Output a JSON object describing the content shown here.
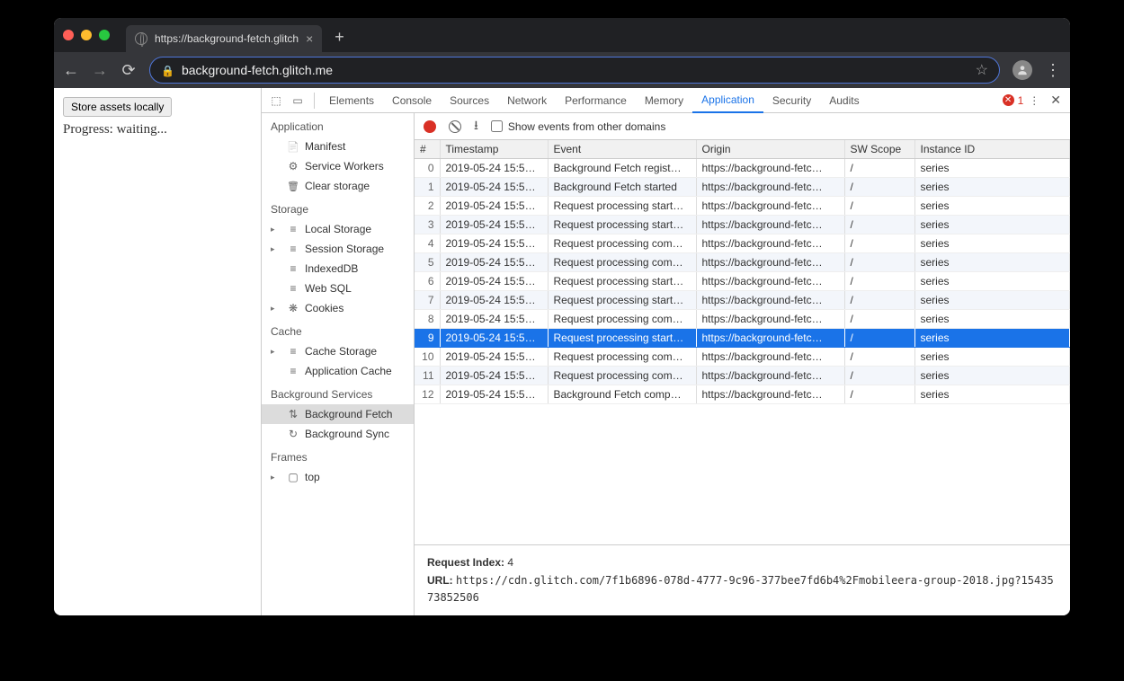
{
  "browser": {
    "tab_title": "https://background-fetch.glitch",
    "url_display": "background-fetch.glitch.me"
  },
  "page": {
    "button_label": "Store assets locally",
    "progress_text": "Progress: waiting..."
  },
  "devtools": {
    "tabs": [
      "Elements",
      "Console",
      "Sources",
      "Network",
      "Performance",
      "Memory",
      "Application",
      "Security",
      "Audits"
    ],
    "active_tab": "Application",
    "error_count": "1",
    "sidebar": {
      "groups": [
        {
          "title": "Application",
          "items": [
            {
              "icon": "i-file",
              "label": "Manifest"
            },
            {
              "icon": "i-gear",
              "label": "Service Workers"
            },
            {
              "icon": "i-trash",
              "label": "Clear storage"
            }
          ]
        },
        {
          "title": "Storage",
          "items": [
            {
              "tri": "▸",
              "icon": "i-db",
              "label": "Local Storage"
            },
            {
              "tri": "▸",
              "icon": "i-db",
              "label": "Session Storage"
            },
            {
              "icon": "i-db",
              "label": "IndexedDB"
            },
            {
              "icon": "i-db",
              "label": "Web SQL"
            },
            {
              "tri": "▸",
              "icon": "i-cookie",
              "label": "Cookies"
            }
          ]
        },
        {
          "title": "Cache",
          "items": [
            {
              "tri": "▸",
              "icon": "i-db",
              "label": "Cache Storage"
            },
            {
              "icon": "i-db",
              "label": "Application Cache"
            }
          ]
        },
        {
          "title": "Background Services",
          "items": [
            {
              "icon": "i-updown",
              "label": "Background Fetch",
              "selected": true
            },
            {
              "icon": "i-sync",
              "label": "Background Sync"
            }
          ]
        },
        {
          "title": "Frames",
          "items": [
            {
              "tri": "▸",
              "icon": "i-box",
              "label": "top"
            }
          ]
        }
      ]
    },
    "toolbar": {
      "checkbox_label": "Show events from other domains"
    },
    "table": {
      "headers": [
        "#",
        "Timestamp",
        "Event",
        "Origin",
        "SW Scope",
        "Instance ID"
      ],
      "rows": [
        {
          "idx": "0",
          "ts": "2019-05-24 15:5…",
          "ev": "Background Fetch regist…",
          "or": "https://background-fetc…",
          "sw": "/",
          "iid": "series"
        },
        {
          "idx": "1",
          "ts": "2019-05-24 15:5…",
          "ev": "Background Fetch started",
          "or": "https://background-fetc…",
          "sw": "/",
          "iid": "series"
        },
        {
          "idx": "2",
          "ts": "2019-05-24 15:5…",
          "ev": "Request processing start…",
          "or": "https://background-fetc…",
          "sw": "/",
          "iid": "series"
        },
        {
          "idx": "3",
          "ts": "2019-05-24 15:5…",
          "ev": "Request processing start…",
          "or": "https://background-fetc…",
          "sw": "/",
          "iid": "series"
        },
        {
          "idx": "4",
          "ts": "2019-05-24 15:5…",
          "ev": "Request processing com…",
          "or": "https://background-fetc…",
          "sw": "/",
          "iid": "series"
        },
        {
          "idx": "5",
          "ts": "2019-05-24 15:5…",
          "ev": "Request processing com…",
          "or": "https://background-fetc…",
          "sw": "/",
          "iid": "series"
        },
        {
          "idx": "6",
          "ts": "2019-05-24 15:5…",
          "ev": "Request processing start…",
          "or": "https://background-fetc…",
          "sw": "/",
          "iid": "series"
        },
        {
          "idx": "7",
          "ts": "2019-05-24 15:5…",
          "ev": "Request processing start…",
          "or": "https://background-fetc…",
          "sw": "/",
          "iid": "series"
        },
        {
          "idx": "8",
          "ts": "2019-05-24 15:5…",
          "ev": "Request processing com…",
          "or": "https://background-fetc…",
          "sw": "/",
          "iid": "series"
        },
        {
          "idx": "9",
          "ts": "2019-05-24 15:5…",
          "ev": "Request processing start…",
          "or": "https://background-fetc…",
          "sw": "/",
          "iid": "series",
          "selected": true
        },
        {
          "idx": "10",
          "ts": "2019-05-24 15:5…",
          "ev": "Request processing com…",
          "or": "https://background-fetc…",
          "sw": "/",
          "iid": "series"
        },
        {
          "idx": "11",
          "ts": "2019-05-24 15:5…",
          "ev": "Request processing com…",
          "or": "https://background-fetc…",
          "sw": "/",
          "iid": "series"
        },
        {
          "idx": "12",
          "ts": "2019-05-24 15:5…",
          "ev": "Background Fetch comp…",
          "or": "https://background-fetc…",
          "sw": "/",
          "iid": "series"
        }
      ]
    },
    "detail": {
      "request_index_label": "Request Index:",
      "request_index": "4",
      "url_label": "URL:",
      "url": "https://cdn.glitch.com/7f1b6896-078d-4777-9c96-377bee7fd6b4%2Fmobileera-group-2018.jpg?1543573852506"
    }
  }
}
